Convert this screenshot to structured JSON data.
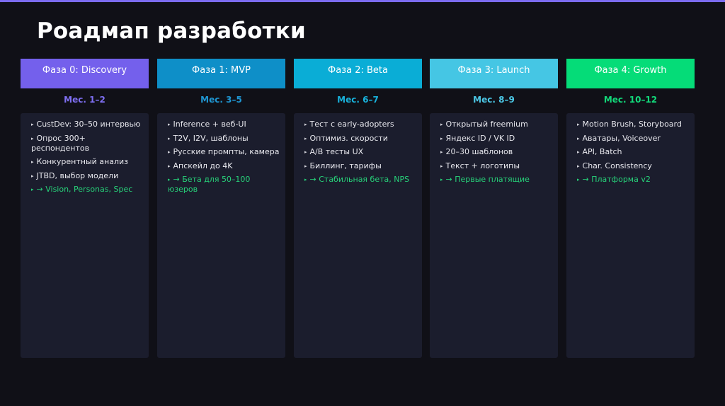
{
  "title": "Роадмап разработки",
  "phases": [
    {
      "header": "Фаза 0: Discovery",
      "color": "#7460ec",
      "month": "Мес. 1–2",
      "month_color": "#7f6ff2",
      "items": [
        "CustDev: 30–50 интервью",
        "Опрос 300+ респондентов",
        "Конкурентный анализ",
        "JTBD, выбор модели"
      ],
      "result": "→ Vision, Personas, Spec"
    },
    {
      "header": "Фаза 1: MVP",
      "color": "#0e8fc8",
      "month": "Мес. 3–5",
      "month_color": "#1f96d2",
      "items": [
        "Inference + веб-UI",
        "T2V, I2V, шаблоны",
        "Русские промпты, камера",
        "Апскейл до 4K"
      ],
      "result": "→ Бета для 50–100 юзеров"
    },
    {
      "header": "Фаза 2: Beta",
      "color": "#0aadd6",
      "month": "Мес. 6–7",
      "month_color": "#18b2dc",
      "items": [
        "Тест с early-adopters",
        "Оптимиз. скорости",
        "A/B тесты UX",
        "Биллинг, тарифы"
      ],
      "result": "→ Стабильная бета, NPS"
    },
    {
      "header": "Фаза 3: Launch",
      "color": "#45c6e4",
      "month": "Мес. 8–9",
      "month_color": "#4cc8e6",
      "items": [
        "Открытый freemium",
        "Яндекс ID / VK ID",
        "20–30 шаблонов",
        "Текст + логотипы"
      ],
      "result": "→ Первые платящие"
    },
    {
      "header": "Фаза 4: Growth",
      "color": "#05dc78",
      "month": "Мес. 10–12",
      "month_color": "#12d97a",
      "items": [
        "Motion Brush, Storyboard",
        "Аватары, Voiceover",
        "API, Batch",
        "Char. Consistency"
      ],
      "result": "→ Платформа v2"
    }
  ]
}
